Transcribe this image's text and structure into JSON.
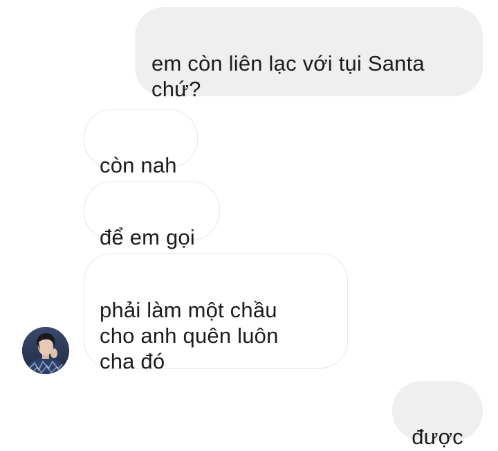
{
  "conversation": {
    "messages": [
      {
        "side": "sent",
        "text": "em còn liên lạc với tụi Santa\nchứ?"
      },
      {
        "side": "received",
        "text": "còn nah"
      },
      {
        "side": "received",
        "text": "để em gọi"
      },
      {
        "side": "received",
        "text": "phải làm một chầu\ncho anh quên luôn\ncha đó"
      },
      {
        "side": "sent",
        "text": "được"
      }
    ]
  },
  "colors": {
    "sent_bubble": "#efefef",
    "received_border": "#e6e6e6",
    "text": "#1c1c1c"
  },
  "avatar": {
    "icon": "contact-avatar-photo"
  }
}
